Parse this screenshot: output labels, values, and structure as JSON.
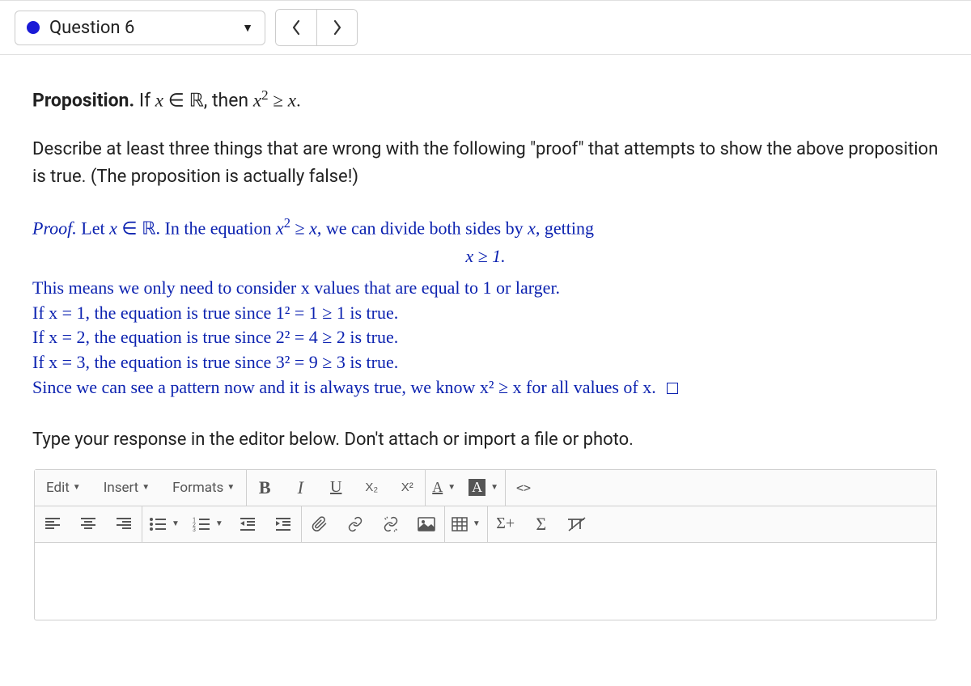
{
  "topbar": {
    "question_label": "Question 6",
    "prev": "<",
    "next": ">"
  },
  "proposition": {
    "label": "Proposition.",
    "text_before": " If ",
    "x": "x",
    "elem": " ∈ ",
    "R": "ℝ",
    "mid": ", then ",
    "x2": "x",
    "sup": "2",
    "ge": " ≥ ",
    "x3": "x",
    "period": "."
  },
  "description": "Describe at least three things that are wrong with the following \"proof\" that attempts to show the above proposition is true. (The proposition is actually false!)",
  "proof": {
    "l1a": "Proof.",
    "l1b": " Let ",
    "l1c": "x",
    "l1d": " ∈ ",
    "l1e": "ℝ",
    "l1f": ". In the equation ",
    "l1g": "x",
    "l1h": "2",
    "l1i": " ≥ ",
    "l1j": "x",
    "l1k": ", we can divide both sides by ",
    "l1l": "x",
    "l1m": ", getting",
    "center": "x ≥ 1.",
    "l2": "This means we only need to consider x values that are equal to 1 or larger.",
    "l3": "If x = 1, the equation is true since 1² = 1 ≥ 1 is true.",
    "l4": "If x = 2, the equation is true since 2² = 4 ≥ 2 is true.",
    "l5": "If x = 3, the equation is true since 3² = 9 ≥ 3 is true.",
    "l6": "Since we can see a pattern now and it is always true, we know x² ≥ x for all values of x."
  },
  "instruction": "Type your response in the editor below. Don't attach or import a file or photo.",
  "toolbar": {
    "edit": "Edit",
    "insert": "Insert",
    "formats": "Formats",
    "B": "B",
    "I": "I",
    "U": "U",
    "sub": "X₂",
    "sup": "X²",
    "A": "A",
    "A2": "A",
    "code": "<>",
    "sigma_plus": "Σ+",
    "sigma": "Σ"
  }
}
